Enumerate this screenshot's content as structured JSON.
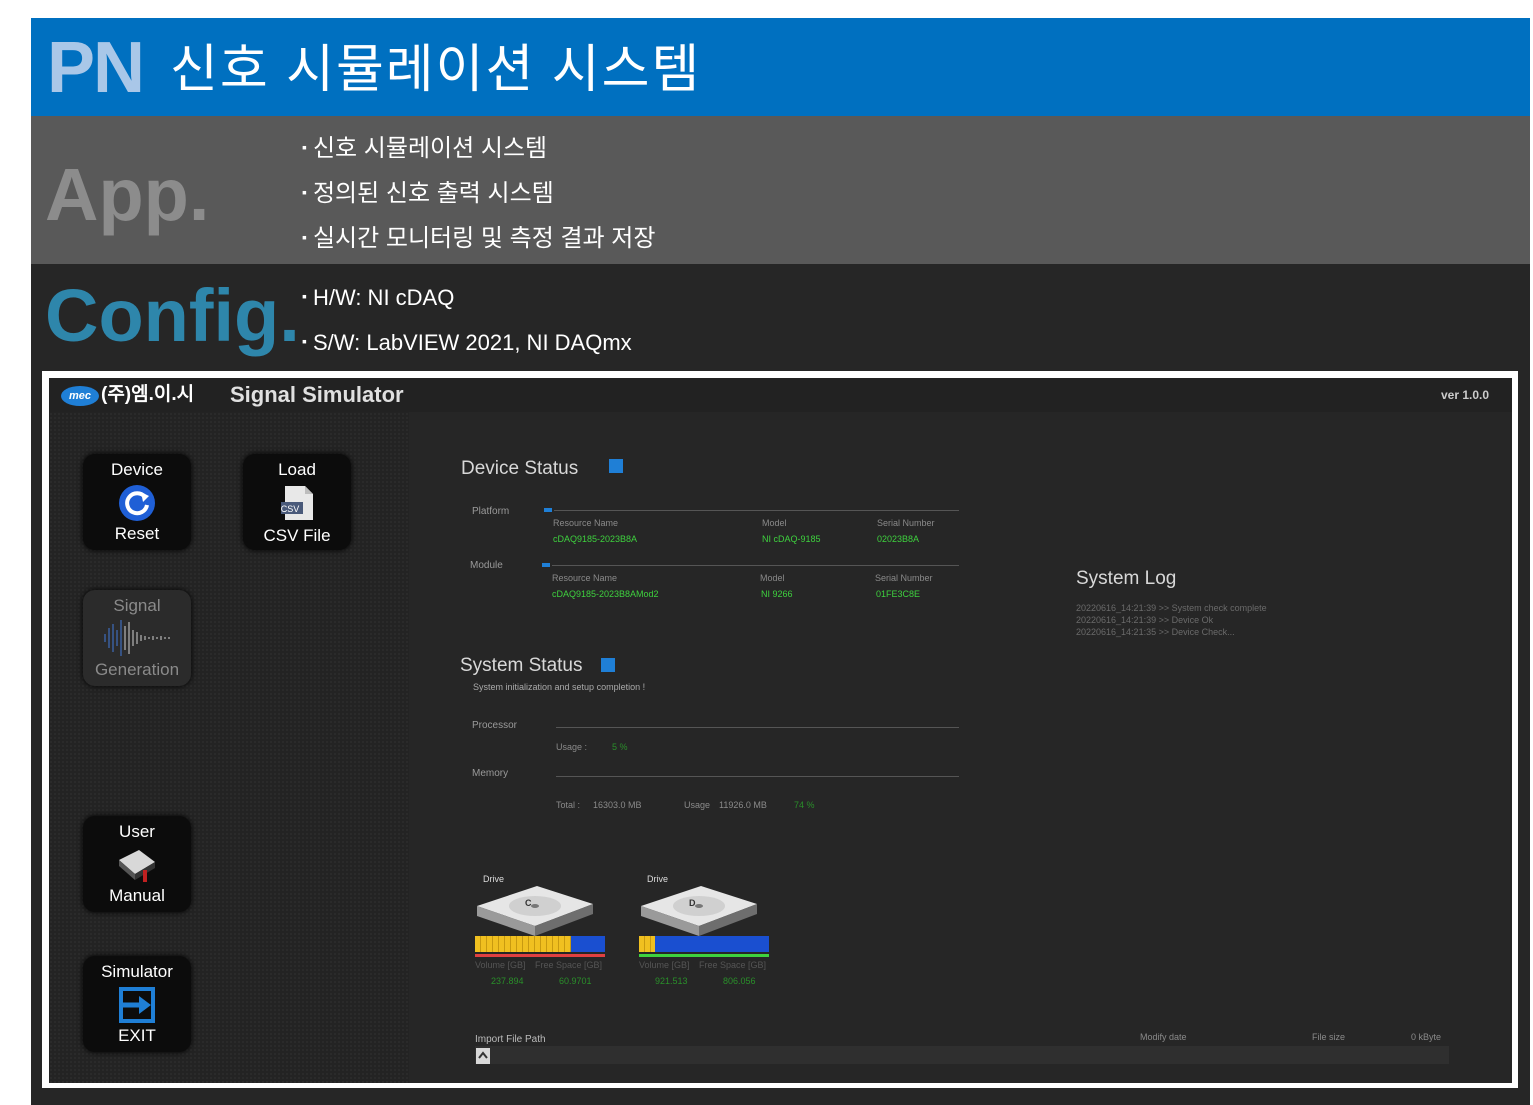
{
  "header": {
    "code": "PN",
    "title": "신호 시뮬레이션 시스템"
  },
  "app": {
    "heading": "App.",
    "bullets": [
      "신호 시뮬레이션 시스템",
      "정의된 신호 출력 시스템",
      "실시간 모니터링 및 측정 결과 저장"
    ]
  },
  "config": {
    "heading": "Config.",
    "bullets": [
      "H/W: NI cDAQ",
      "S/W: LabVIEW 2021, NI DAQmx"
    ]
  },
  "simulator": {
    "logo_text": "mec",
    "company": "(주)엠.이.시",
    "title": "Signal Simulator",
    "version": "ver 1.0.0",
    "buttons": {
      "device": {
        "top": "Device",
        "bottom": "Reset"
      },
      "load": {
        "top": "Load",
        "bottom": "CSV File",
        "badge": "CSV"
      },
      "signal": {
        "top": "Signal",
        "bottom": "Generation"
      },
      "manual": {
        "top": "User",
        "bottom": "Manual"
      },
      "exit": {
        "top": "Simulator",
        "bottom": "EXIT"
      }
    },
    "device_status": {
      "title": "Device Status",
      "platform": {
        "label": "Platform",
        "headers": [
          "Resource Name",
          "Model",
          "Serial Number"
        ],
        "values": [
          "cDAQ9185-2023B8A",
          "NI cDAQ-9185",
          "02023B8A"
        ]
      },
      "module": {
        "label": "Module",
        "headers": [
          "Resource Name",
          "Model",
          "Serial Number"
        ],
        "values": [
          "cDAQ9185-2023B8AMod2",
          "NI 9266",
          "01FE3C8E"
        ]
      }
    },
    "system_status": {
      "title": "System Status",
      "message": "System initialization and setup completion !",
      "processor_label": "Processor",
      "usage_label": "Usage :",
      "usage_value": "5 %",
      "memory_label": "Memory",
      "total_label": "Total :",
      "total_value": "16303.0 MB",
      "mem_usage_label": "Usage",
      "mem_usage_value": "11926.0 MB",
      "mem_percent": "74 %"
    },
    "drives": [
      {
        "label": "Drive",
        "letter": "C",
        "col1": "Volume [GB]",
        "col2": "Free Space [GB]",
        "volume": "237.894",
        "free": "60.9701",
        "used_fraction": 0.74,
        "status_color": "#e04040"
      },
      {
        "label": "Drive",
        "letter": "D",
        "col1": "Volume [GB]",
        "col2": "Free Space [GB]",
        "volume": "921.513",
        "free": "806.056",
        "used_fraction": 0.12,
        "status_color": "#3ed13e"
      }
    ],
    "system_log": {
      "title": "System Log",
      "entries": [
        "20220616_14:21:39 >> System check complete",
        "20220616_14:21:39 >> Device Ok",
        "20220616_14:21:35 >> Device Check..."
      ]
    },
    "import": {
      "label": "Import File Path",
      "modify_label": "Modify date",
      "size_label": "File size",
      "size_value": "0 kByte"
    }
  }
}
